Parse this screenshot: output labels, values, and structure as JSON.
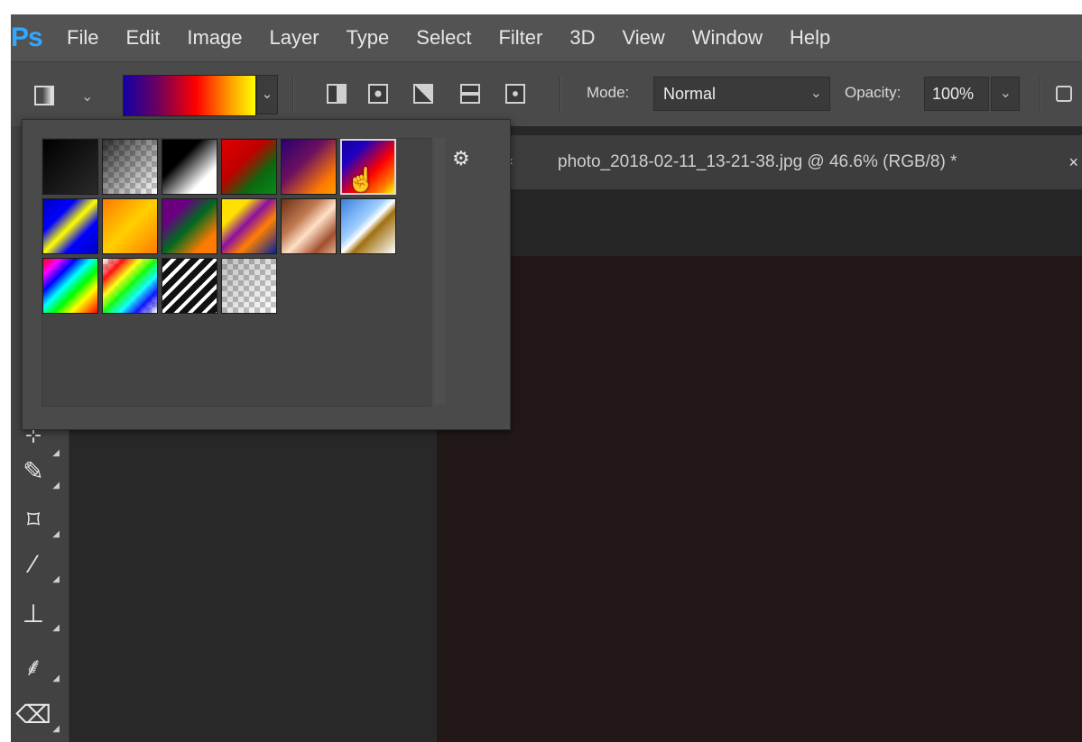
{
  "app": {
    "logo": "Ps"
  },
  "menu": [
    "File",
    "Edit",
    "Image",
    "Layer",
    "Type",
    "Select",
    "Filter",
    "3D",
    "View",
    "Window",
    "Help"
  ],
  "options": {
    "mode_label": "Mode:",
    "mode_value": "Normal",
    "opacity_label": "Opacity:",
    "opacity_value": "100%"
  },
  "document_tab": {
    "title": "photo_2018-02-11_13-21-38.jpg @ 46.6% (RGB/8) *",
    "close": "×"
  },
  "gradient_picker": {
    "settings_icon": "gear-icon",
    "swatches": [
      "foreground-to-background",
      "foreground-to-transparent",
      "black-white",
      "red-green",
      "violet-orange",
      "blue-red-yellow",
      "blue-yellow-blue",
      "orange-yellow-orange",
      "violet-green-orange",
      "yellow-violet-orange-blue",
      "copper",
      "chrome",
      "spectrum",
      "transparent-rainbow",
      "transparent-stripes",
      "neutral-density"
    ],
    "selected": "blue-red-yellow"
  },
  "tools": [
    "eyedropper-tool",
    "frame-tool",
    "brush-tool",
    "stamp-tool",
    "history-brush-tool",
    "eraser-tool"
  ]
}
